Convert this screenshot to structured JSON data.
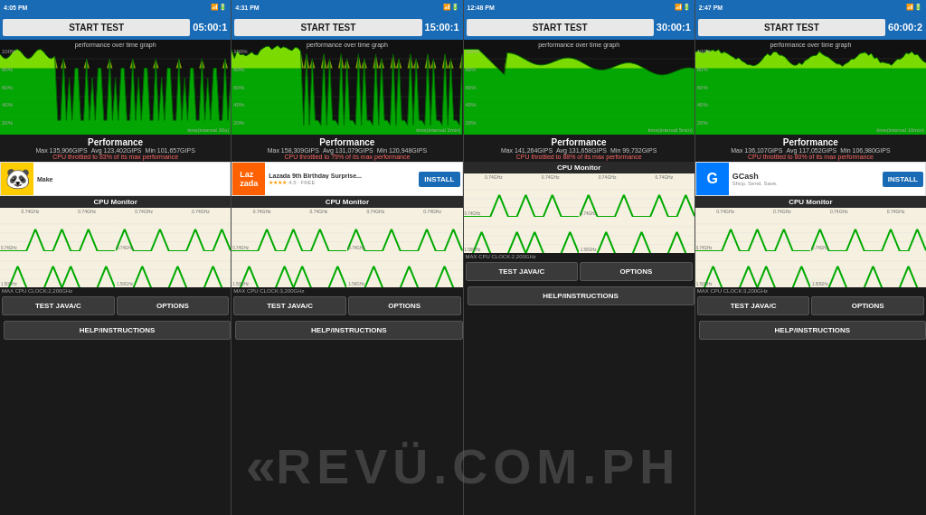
{
  "panels": [
    {
      "id": "panel1",
      "status_time": "4:05 PM",
      "timer": "05:00:1",
      "start_test_label": "START TEST",
      "perf_graph_label": "performance over time graph",
      "time_interval_label": "time(interval 30s)",
      "stats_title": "Performance",
      "stat_max": "Max 135,906GIPS",
      "stat_avg": "Avg 123,402GIPS",
      "stat_min": "Min 101,657GIPS",
      "throttle_text": "CPU throttled to 83% of its max performance",
      "ad_icon": "🐼",
      "ad_title": "Make",
      "ad_subtitle": "",
      "ad_has_install": false,
      "max_cpu_label": "MAX CPU CLOCK:2,200GHz",
      "btn1": "TEST JAVA/C",
      "btn2": "OPTIONS",
      "help_btn": "HELP/INSTRUCTIONS",
      "y_labels": [
        "100%",
        "80%",
        "60%",
        "40%",
        "20%"
      ],
      "graph_color": "#00ff00",
      "graph_type": "spiky"
    },
    {
      "id": "panel2",
      "status_time": "4:31 PM",
      "timer": "15:00:1",
      "start_test_label": "START TEST",
      "perf_graph_label": "performance over time graph",
      "time_interval_label": "time(interval 2min)",
      "stats_title": "Performance",
      "stat_max": "Max 158,309GIPS",
      "stat_avg": "Avg 131,079GIPS",
      "stat_min": "Min 120,948GIPS",
      "throttle_text": "CPU throttled to 79% of its max performance",
      "ad_icon": "Laz",
      "ad_title": "Lazada 9th Birthday Surprise...",
      "ad_subtitle": "4.5 ★ FREE",
      "ad_has_install": true,
      "max_cpu_label": "MAX CPU CLOCK:3,200GHz",
      "btn1": "TEST JAVA/C",
      "btn2": "OPTIONS",
      "help_btn": "HELP/INSTRUCTIONS",
      "y_labels": [
        "100%",
        "80%",
        "60%",
        "40%",
        "20%"
      ],
      "graph_color": "#00ff00",
      "graph_type": "medium"
    },
    {
      "id": "panel3",
      "status_time": "12:48 PM",
      "timer": "30:00:1",
      "start_test_label": "START TEST",
      "perf_graph_label": "performance over time graph",
      "time_interval_label": "time(interval 5min)",
      "stats_title": "Performance",
      "stat_max": "Max 141,264GIPS",
      "stat_avg": "Avg 131,658GIPS",
      "stat_min": "Min 99,732GIPS",
      "throttle_text": "CPU throttled to 88% of its max performance",
      "ad_icon": "",
      "ad_title": "",
      "ad_subtitle": "",
      "ad_has_install": false,
      "max_cpu_label": "MAX CPU CLOCK:2,200GHz",
      "btn1": "TEST JAVA/C",
      "btn2": "OPTIONS",
      "help_btn": "HELP/INSTRUCTIONS",
      "y_labels": [
        "100%",
        "80%",
        "60%",
        "40%",
        "20%"
      ],
      "graph_color": "#00ff00",
      "graph_type": "long"
    },
    {
      "id": "panel4",
      "status_time": "2:47 PM",
      "timer": "60:00:2",
      "start_test_label": "START TEST",
      "perf_graph_label": "performance over time graph",
      "time_interval_label": "time(interval 10min)",
      "stats_title": "Performance",
      "stat_max": "Max 136,107GIPS",
      "stat_avg": "Avg 117,052GIPS",
      "stat_min": "Min 106,980GIPS",
      "throttle_text": "CPU throttled to 80% of its max performance",
      "ad_icon": "G",
      "ad_title": "GCash",
      "ad_subtitle": "Shop. Send. Save.",
      "ad_has_install": true,
      "max_cpu_label": "MAX CPU CLOCK:3,200GHz",
      "btn1": "TEST JAVA/C",
      "btn2": "OPTIONS",
      "help_btn": "HELP/INSTRUCTIONS",
      "y_labels": [
        "100%",
        "80%",
        "60%",
        "40%",
        "20%"
      ],
      "graph_color": "#00ff00",
      "graph_type": "long2"
    }
  ],
  "watermark": {
    "text": "REVÜ.COM.PH"
  }
}
